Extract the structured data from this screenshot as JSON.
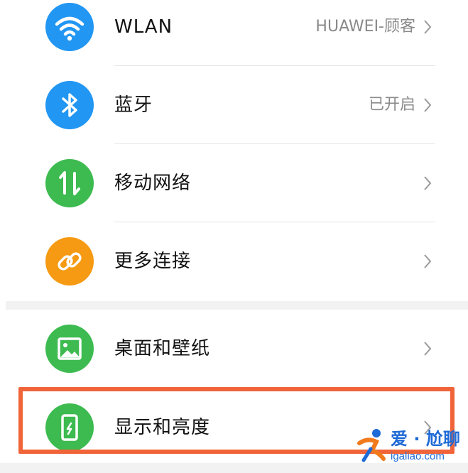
{
  "colors": {
    "wifi_icon_bg": "#2196f3",
    "bluetooth_icon_bg": "#2196f3",
    "mobile_network_icon_bg": "#3dbb50",
    "more_connections_icon_bg": "#f59a12",
    "wallpaper_icon_bg": "#3dbb50",
    "display_icon_bg": "#3dbb50",
    "highlight_border": "#f1643a",
    "watermark_blue": "#1e6ad6"
  },
  "settings": {
    "items": [
      {
        "id": "wlan",
        "icon": "wifi-icon",
        "label": "WLAN",
        "value": "HUAWEI-顾客"
      },
      {
        "id": "bluetooth",
        "icon": "bluetooth-icon",
        "label": "蓝牙",
        "value": "已开启"
      },
      {
        "id": "mobile-network",
        "icon": "mobile-network-icon",
        "label": "移动网络",
        "value": ""
      },
      {
        "id": "more-connections",
        "icon": "link-icon",
        "label": "更多连接",
        "value": ""
      },
      {
        "id": "home-wallpaper",
        "icon": "image-icon",
        "label": "桌面和壁纸",
        "value": ""
      },
      {
        "id": "display-brightness",
        "icon": "phone-display-icon",
        "label": "显示和亮度",
        "value": ""
      }
    ]
  },
  "watermark": {
    "brand": "爱 · 尬聊",
    "url": "igaliao.com"
  }
}
